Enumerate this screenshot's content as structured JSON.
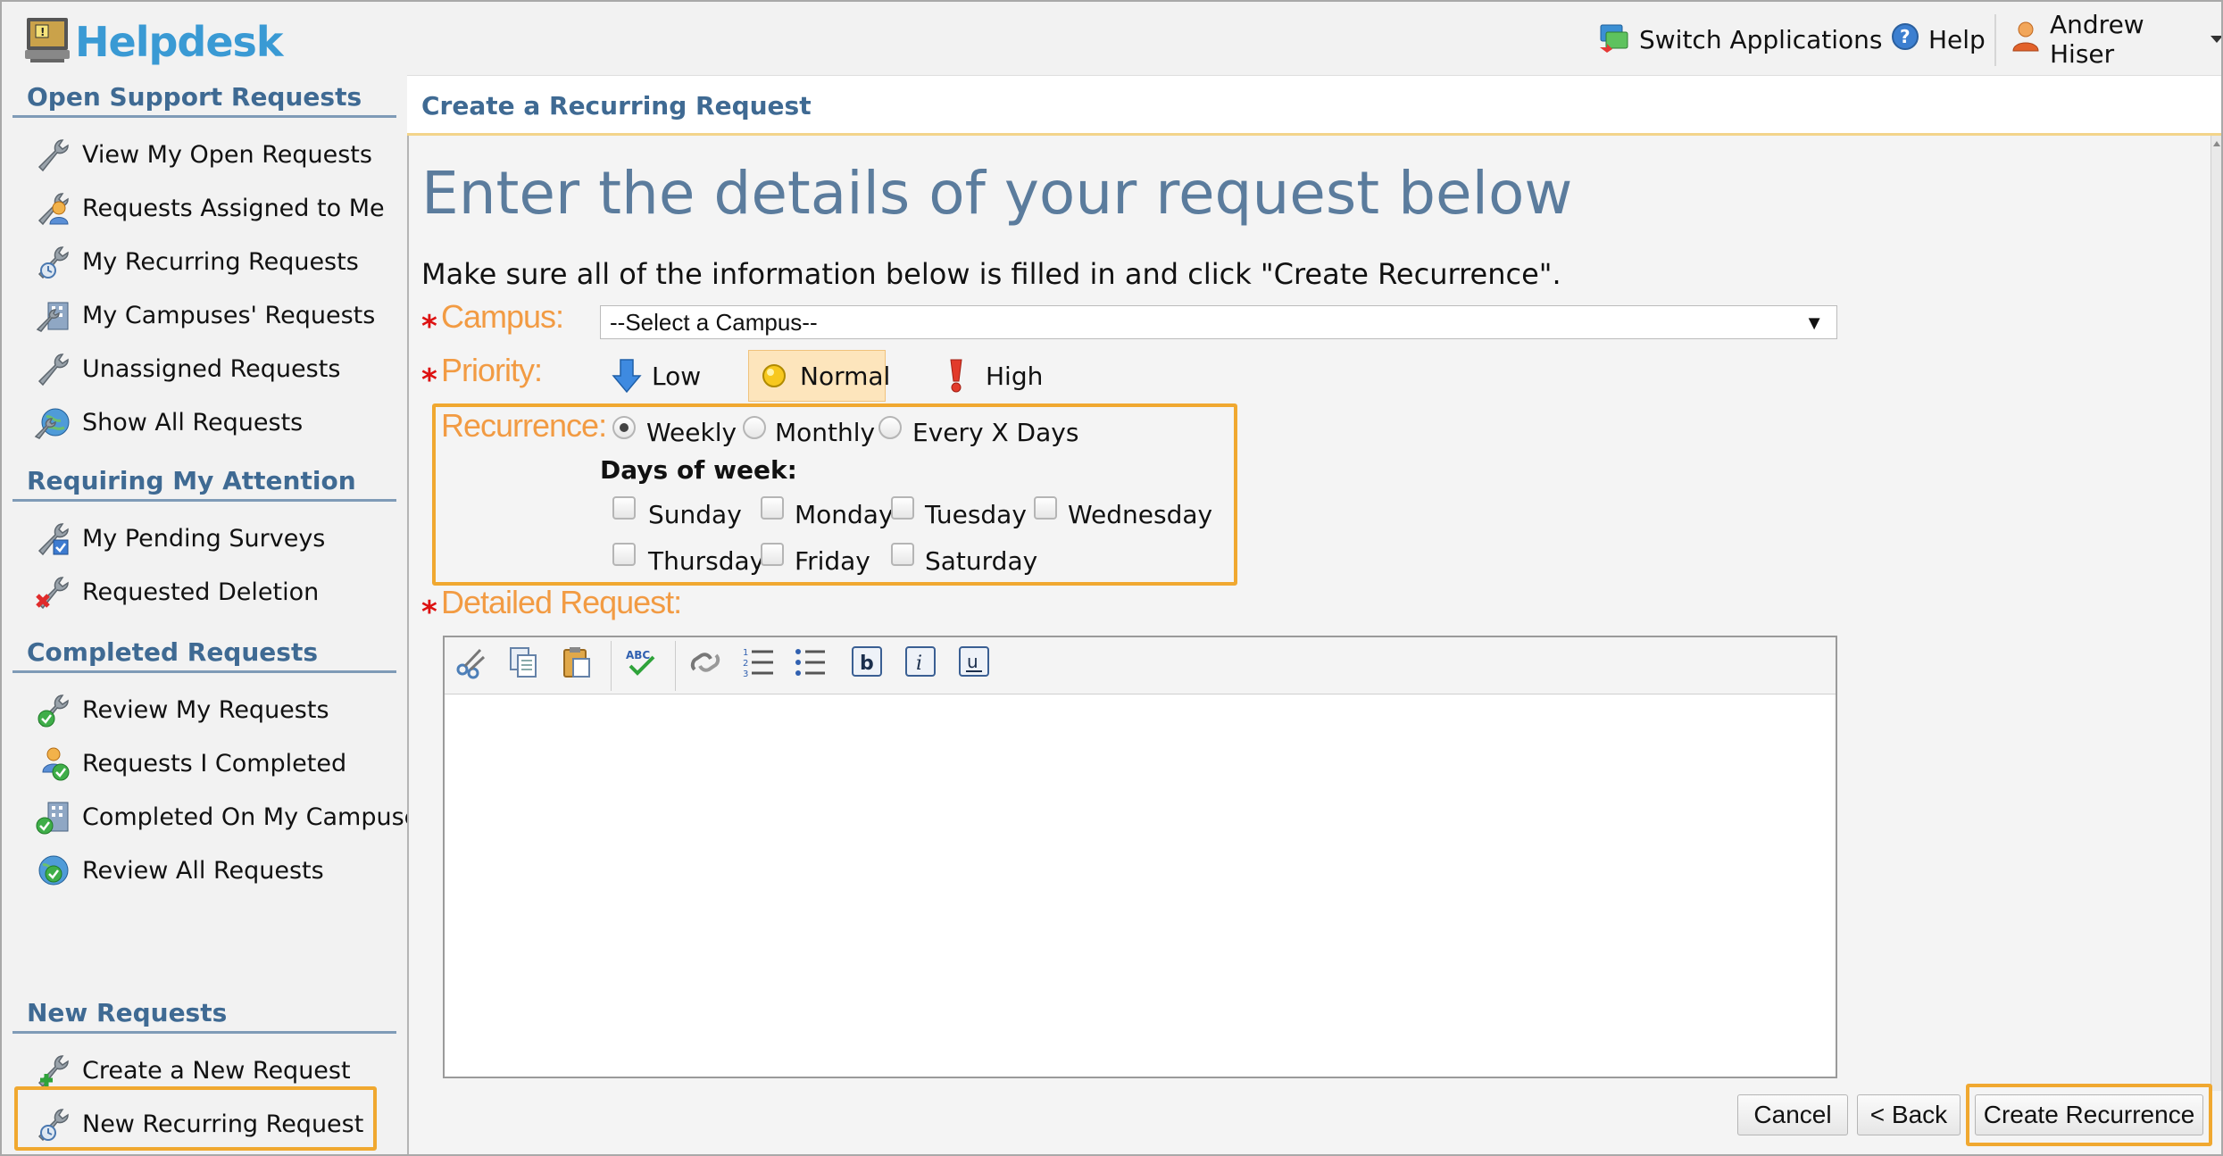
{
  "app": {
    "title": "Helpdesk"
  },
  "topbar": {
    "switch_label": "Switch Applications",
    "help_label": "Help",
    "user_name": "Andrew Hiser"
  },
  "sidebar": {
    "sections": [
      {
        "title": "Open Support Requests",
        "items": [
          {
            "label": "View My Open Requests",
            "icon": "wrench-icon"
          },
          {
            "label": "Requests Assigned to Me",
            "icon": "user-wrench-icon"
          },
          {
            "label": "My Recurring Requests",
            "icon": "recurring-wrench-icon"
          },
          {
            "label": "My Campuses' Requests",
            "icon": "building-wrench-icon"
          },
          {
            "label": "Unassigned Requests",
            "icon": "wrench-icon"
          },
          {
            "label": "Show All Requests",
            "icon": "globe-wrench-icon"
          }
        ]
      },
      {
        "title": "Requiring My Attention",
        "items": [
          {
            "label": "My Pending Surveys",
            "icon": "survey-wrench-icon"
          },
          {
            "label": "Requested Deletion",
            "icon": "delete-wrench-icon"
          }
        ]
      },
      {
        "title": "Completed Requests",
        "items": [
          {
            "label": "Review My Requests",
            "icon": "check-wrench-icon"
          },
          {
            "label": "Requests I Completed",
            "icon": "user-check-icon"
          },
          {
            "label": "Completed On My Campuses",
            "icon": "building-check-icon"
          },
          {
            "label": "Review All Requests",
            "icon": "globe-check-icon"
          }
        ]
      },
      {
        "title": "New Requests",
        "items": [
          {
            "label": "Create a New Request",
            "icon": "add-wrench-icon"
          },
          {
            "label": "New Recurring Request",
            "icon": "recurring-wrench-icon"
          }
        ]
      }
    ]
  },
  "main": {
    "header_title": "Create a Recurring Request",
    "heading": "Enter the details of your request below",
    "instructions": "Make sure all of the information below is filled in and click \"Create Recurrence\".",
    "required_marker": "*",
    "campus": {
      "label": "Campus:",
      "selected": "--Select a Campus--"
    },
    "priority": {
      "label": "Priority:",
      "options": [
        "Low",
        "Normal",
        "High"
      ],
      "selected": "Normal"
    },
    "recurrence": {
      "label": "Recurrence:",
      "options": [
        "Weekly",
        "Monthly",
        "Every X Days"
      ],
      "selected": "Weekly",
      "days_title": "Days of week:",
      "days": [
        "Sunday",
        "Monday",
        "Tuesday",
        "Wednesday",
        "Thursday",
        "Friday",
        "Saturday"
      ]
    },
    "detailed": {
      "label": "Detailed Request:",
      "value": ""
    },
    "buttons": {
      "cancel": "Cancel",
      "back": "< Back",
      "create": "Create Recurrence"
    }
  },
  "colors": {
    "accent_blue": "#3f6a93",
    "heading_blue": "#5b7c9d",
    "label_orange": "#f29b43",
    "highlight": "#f0a830",
    "logo_blue": "#3a9ad4"
  }
}
